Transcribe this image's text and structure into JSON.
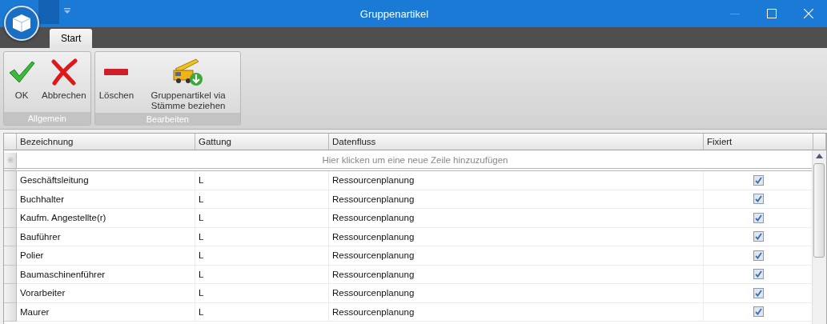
{
  "window": {
    "title": "Gruppenartikel"
  },
  "tabs": [
    {
      "label": "Start",
      "selected": true
    }
  ],
  "ribbon_groups": [
    {
      "label": "Allgemein",
      "buttons": [
        {
          "kind": "ok",
          "label": "OK"
        },
        {
          "kind": "cancel",
          "label": "Abbrechen"
        }
      ]
    },
    {
      "label": "Bearbeiten",
      "buttons": [
        {
          "kind": "delete",
          "label": "Löschen"
        },
        {
          "kind": "crane",
          "label": "Gruppenartikel via Stämme beziehen"
        }
      ]
    }
  ],
  "table": {
    "columns": [
      "Bezeichnung",
      "Gattung",
      "Datenfluss",
      "Fixiert"
    ],
    "new_row_placeholder": "Hier klicken um eine neue Zeile hinzuzufügen",
    "rows": [
      {
        "bezeichnung": "Geschäftsleitung",
        "gattung": "L",
        "datenfluss": "Ressourcenplanung",
        "fixiert": true
      },
      {
        "bezeichnung": "Buchhalter",
        "gattung": "L",
        "datenfluss": "Ressourcenplanung",
        "fixiert": true
      },
      {
        "bezeichnung": "Kaufm. Angestellte(r)",
        "gattung": "L",
        "datenfluss": "Ressourcenplanung",
        "fixiert": true
      },
      {
        "bezeichnung": "Bauführer",
        "gattung": "L",
        "datenfluss": "Ressourcenplanung",
        "fixiert": true
      },
      {
        "bezeichnung": "Polier",
        "gattung": "L",
        "datenfluss": "Ressourcenplanung",
        "fixiert": true
      },
      {
        "bezeichnung": "Baumaschinenführer",
        "gattung": "L",
        "datenfluss": "Ressourcenplanung",
        "fixiert": true
      },
      {
        "bezeichnung": "Vorarbeiter",
        "gattung": "L",
        "datenfluss": "Ressourcenplanung",
        "fixiert": true
      },
      {
        "bezeichnung": "Maurer",
        "gattung": "L",
        "datenfluss": "Ressourcenplanung",
        "fixiert": true
      }
    ]
  }
}
